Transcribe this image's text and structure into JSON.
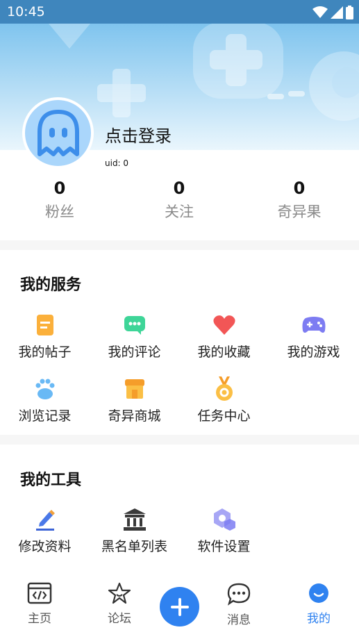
{
  "status_bar": {
    "time": "10:45"
  },
  "profile": {
    "login_text": "点击登录",
    "uid": "uid: 0"
  },
  "stats": [
    {
      "value": "0",
      "label": "粉丝"
    },
    {
      "value": "0",
      "label": "关注"
    },
    {
      "value": "0",
      "label": "奇异果"
    }
  ],
  "services": {
    "title": "我的服务",
    "items": [
      {
        "label": "我的帖子",
        "icon": "posts-icon"
      },
      {
        "label": "我的评论",
        "icon": "comment-icon"
      },
      {
        "label": "我的收藏",
        "icon": "heart-icon"
      },
      {
        "label": "我的游戏",
        "icon": "gamepad-icon"
      },
      {
        "label": "浏览记录",
        "icon": "paw-icon"
      },
      {
        "label": "奇异商城",
        "icon": "shop-icon"
      },
      {
        "label": "任务中心",
        "icon": "medal-icon"
      }
    ]
  },
  "tools": {
    "title": "我的工具",
    "items": [
      {
        "label": "修改资料",
        "icon": "edit-icon"
      },
      {
        "label": "黑名单列表",
        "icon": "bank-icon"
      },
      {
        "label": "软件设置",
        "icon": "settings-icon"
      }
    ]
  },
  "nav": {
    "items": [
      {
        "label": "主页",
        "icon": "code-icon"
      },
      {
        "label": "论坛",
        "icon": "star-icon"
      },
      {
        "label": "消息",
        "icon": "chat-icon"
      },
      {
        "label": "我的",
        "icon": "face-icon"
      }
    ],
    "active_color": "#2f82f0"
  }
}
